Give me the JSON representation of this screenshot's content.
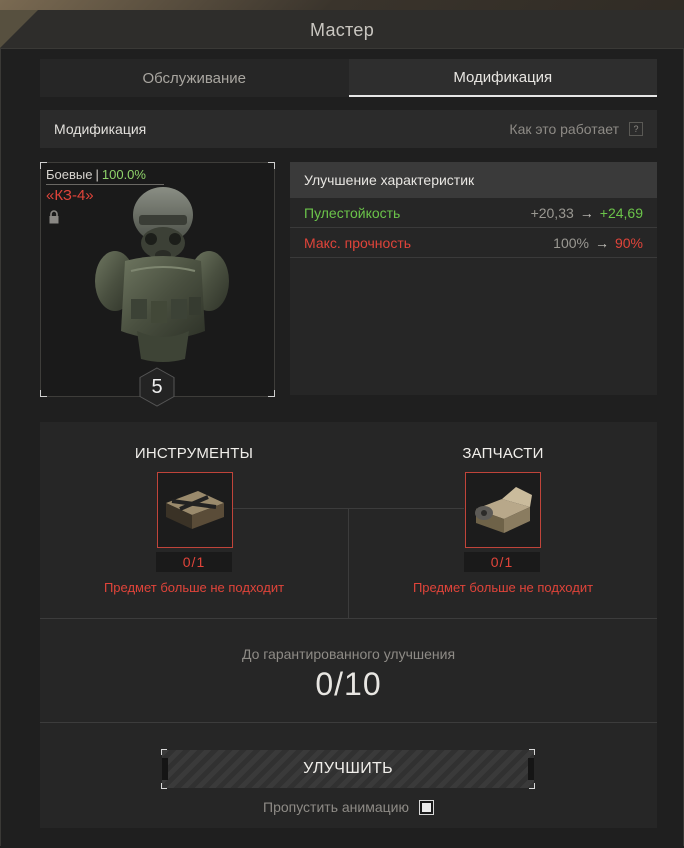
{
  "window": {
    "title": "Мастер"
  },
  "tabs": [
    {
      "label": "Обслуживание",
      "active": false
    },
    {
      "label": "Модификация",
      "active": true
    }
  ],
  "modification_header": {
    "label": "Модификация",
    "how_it_works": "Как это работает",
    "help_icon_text": "?"
  },
  "item": {
    "type": "Боевые",
    "separator": "|",
    "condition": "100.0%",
    "name": "«КЗ-4»",
    "level": "5",
    "locked": true,
    "icon": "armor-suit-icon"
  },
  "stats": {
    "header": "Улучшение характеристик",
    "rows": [
      {
        "name": "Пулестойкость",
        "from": "+20,33",
        "arrow": "→",
        "to": "+24,69",
        "color": "#6bc44a"
      },
      {
        "name": "Макс. прочность",
        "from": "100%",
        "arrow": "→",
        "to": "90%",
        "color": "#e0443a"
      }
    ]
  },
  "materials": {
    "tools": {
      "title": "ИНСТРУМЕНТЫ",
      "count": "0/1",
      "warning": "Предмет больше не подходит",
      "icon": "toolbox-icon"
    },
    "parts": {
      "title": "ЗАПЧАСТИ",
      "count": "0/1",
      "warning": "Предмет больше не подходит",
      "icon": "parts-box-icon"
    }
  },
  "guarantee": {
    "label": "До гарантированного улучшения",
    "value": "0/10"
  },
  "actions": {
    "upgrade_label": "УЛУЧШИТЬ",
    "skip_animation_label": "Пропустить анимацию",
    "skip_animation_checked": true
  },
  "colors": {
    "positive": "#6bc44a",
    "negative": "#e0443a",
    "accent_white": "#e6e6e6"
  }
}
